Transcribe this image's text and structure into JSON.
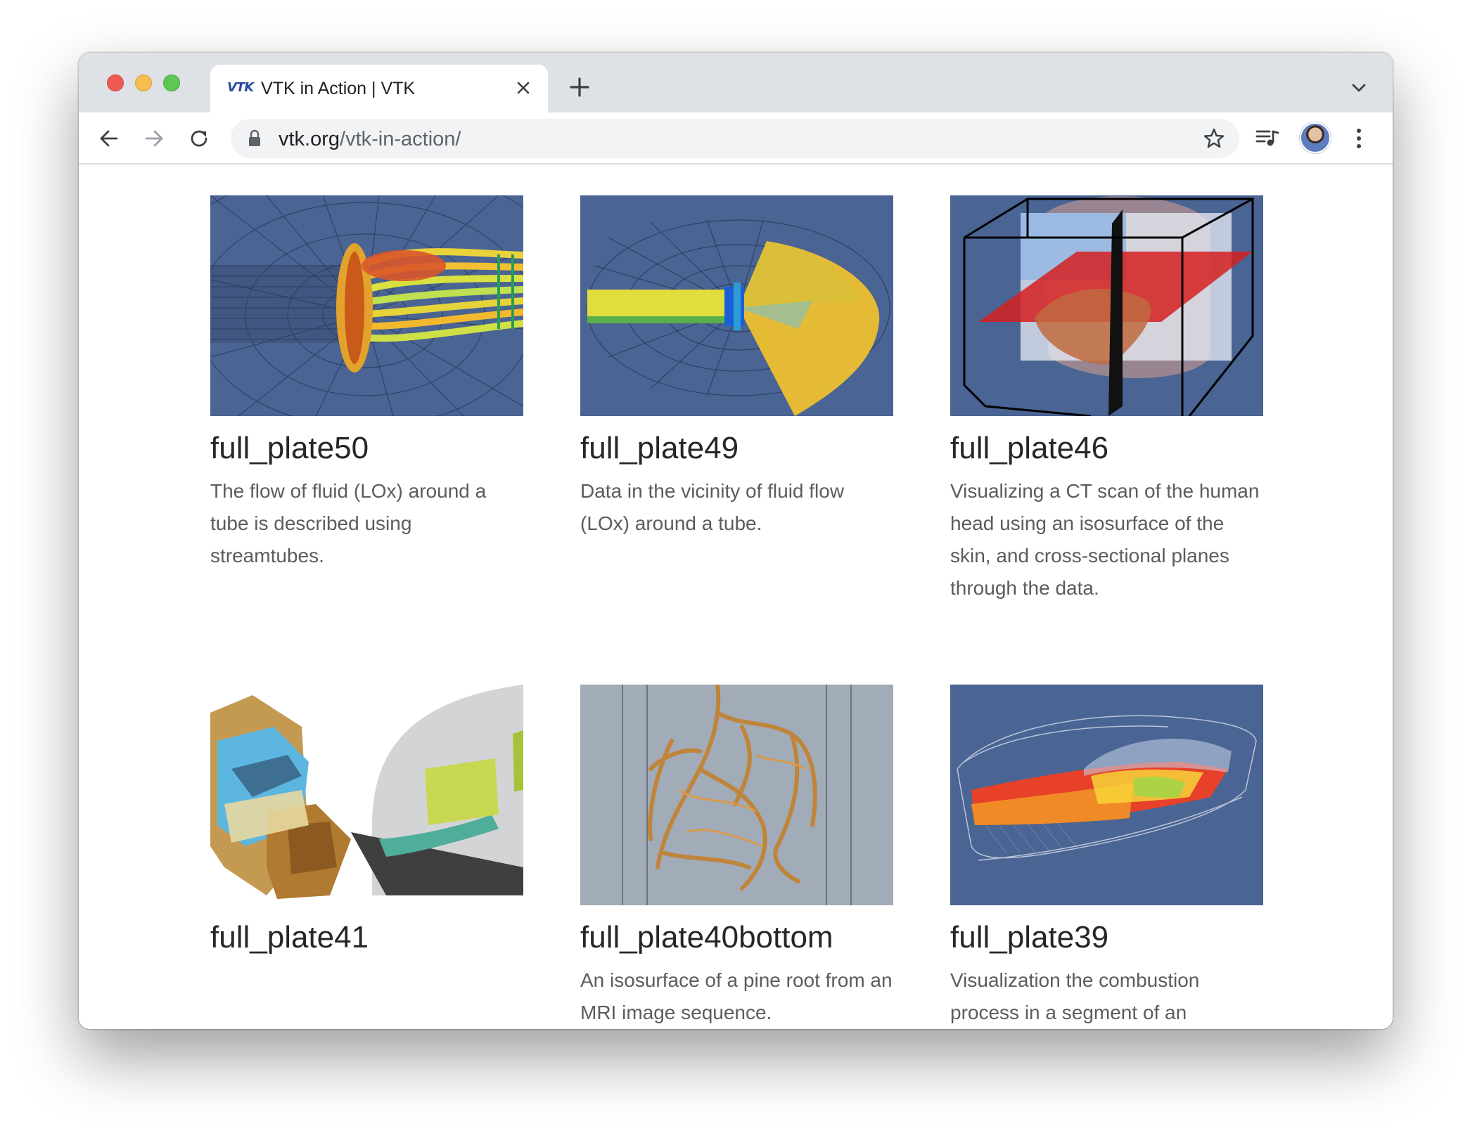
{
  "browser": {
    "tab": {
      "favicon_text": "VTK",
      "title": "VTK in Action | VTK"
    },
    "url": {
      "host": "vtk.org",
      "path": "/vtk-in-action/"
    },
    "icons": {
      "back": "arrow-left-icon",
      "forward": "arrow-right-icon",
      "reload": "reload-icon",
      "lock": "lock-icon",
      "bookmark": "star-icon",
      "media": "media-queue-icon",
      "menu": "kebab-menu-icon",
      "close_tab": "close-icon",
      "new_tab": "plus-icon",
      "tab_search": "chevron-down-icon"
    }
  },
  "gallery": {
    "items": [
      {
        "title": "full_plate50",
        "description": "The flow of fluid (LOx) around a tube is described using streamtubes.",
        "image_alt": "streamtubes-visualization"
      },
      {
        "title": "full_plate49",
        "description": "Data in the vicinity of fluid flow (LOx) around a tube.",
        "image_alt": "fluid-flow-cut-plane"
      },
      {
        "title": "full_plate46",
        "description": "Visualizing a CT scan of the human head using an isosurface of the skin, and cross-sectional planes through the data.",
        "image_alt": "ct-head-isosurface"
      },
      {
        "title": "full_plate41",
        "description": "",
        "image_alt": "mechanical-assembly-cutaway"
      },
      {
        "title": "full_plate40bottom",
        "description": "An isosurface of a pine root from an MRI image sequence.",
        "image_alt": "pine-root-isosurface"
      },
      {
        "title": "full_plate39",
        "description": "Visualization the combustion process in a segment of an",
        "image_alt": "combustion-segment"
      }
    ]
  },
  "colors": {
    "thumb_blue": "#4a6493",
    "tabstrip": "#dee1e6",
    "omnibox": "#f1f3f4"
  }
}
